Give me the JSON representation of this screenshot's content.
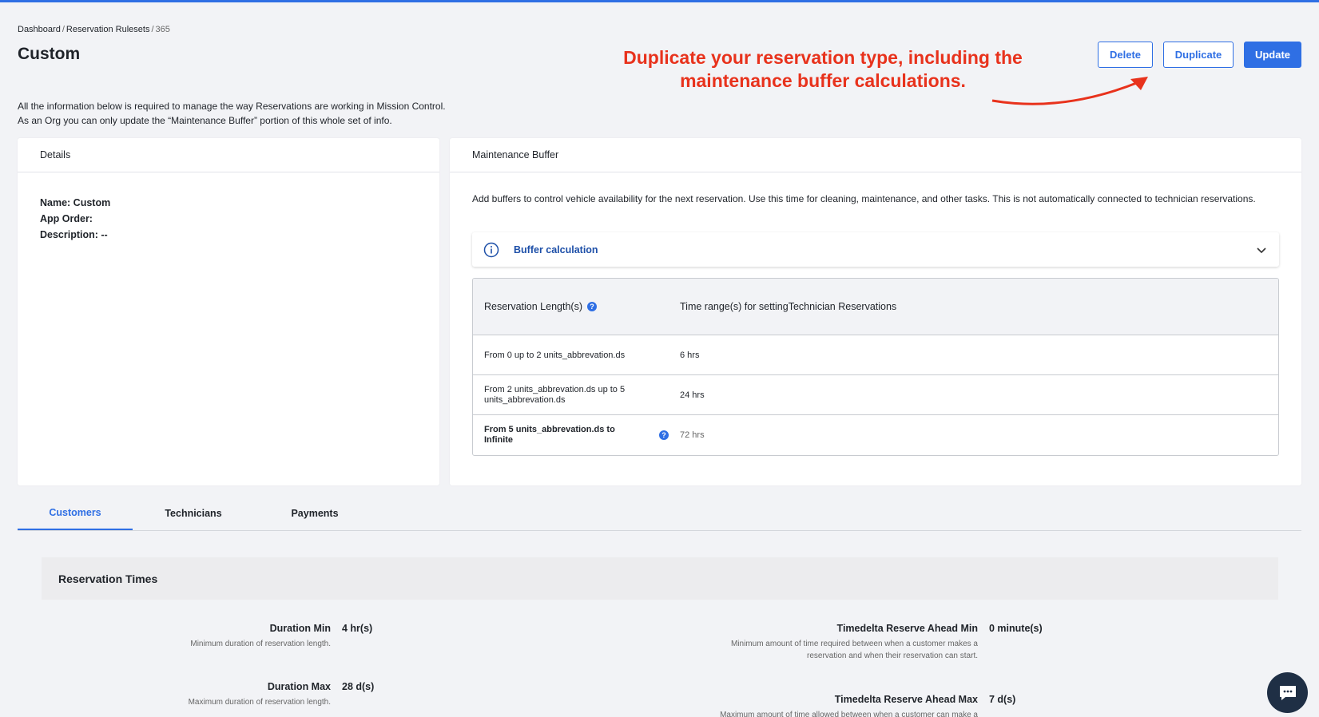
{
  "breadcrumb": {
    "item1": "Dashboard",
    "item2": "Reservation Rulesets",
    "item3": "365"
  },
  "page": {
    "title": "Custom"
  },
  "actions": {
    "delete": "Delete",
    "duplicate": "Duplicate",
    "update": "Update"
  },
  "annotation": {
    "text": "Duplicate your reservation type, including the maintenance buffer calculations."
  },
  "intro": {
    "line1": "All the information below is required to manage the way Reservations are working in Mission Control.",
    "line2": "As an Org you can only update the “Maintenance Buffer” portion of this whole set of info."
  },
  "details": {
    "header": "Details",
    "name": "Name: Custom",
    "app_order": "App Order:",
    "description": "Description: --"
  },
  "buffer": {
    "header": "Maintenance Buffer",
    "description": "Add buffers to control vehicle availability for the next reservation. Use this time for cleaning, maintenance, and other tasks. This is not automatically connected to technician reservations.",
    "accordion_label": "Buffer calculation",
    "table": {
      "col1": "Reservation Length(s)",
      "col2": "Time range(s) for settingTechnician Reservations",
      "rows": [
        {
          "range": "From 0 up to 2 units_abbrevation.ds",
          "time": "6 hrs"
        },
        {
          "range": "From 2 units_abbrevation.ds up to 5 units_abbrevation.ds",
          "time": "24 hrs"
        },
        {
          "range": "From 5 units_abbrevation.ds to Infinite",
          "time": "72 hrs"
        }
      ]
    }
  },
  "tabs": [
    {
      "label": "Customers",
      "active": true
    },
    {
      "label": "Technicians",
      "active": false
    },
    {
      "label": "Payments",
      "active": false
    }
  ],
  "reservation_times": {
    "title": "Reservation Times",
    "duration_min": {
      "label": "Duration Min",
      "value": "4 hr(s)",
      "desc": "Minimum duration of reservation length."
    },
    "duration_max": {
      "label": "Duration Max",
      "value": "28 d(s)",
      "desc": "Maximum duration of reservation length."
    },
    "timedelta_min": {
      "label": "Timedelta Reserve Ahead Min",
      "value": "0 minute(s)",
      "desc1": "Minimum amount of time required between when a customer makes a",
      "desc2": "reservation and when their reservation can start."
    },
    "timedelta_max": {
      "label": "Timedelta Reserve Ahead Max",
      "value": "7 d(s)",
      "desc1": "Maximum amount of time allowed between when a customer can make a"
    }
  },
  "colors": {
    "accent": "#2f6fe4",
    "annotation": "#e8321c",
    "chat": "#1f2f45"
  },
  "icons": {
    "info": "info-circle-icon",
    "chevron": "chevron-down-icon",
    "help": "question-mark-icon",
    "chat": "chat-icon"
  }
}
